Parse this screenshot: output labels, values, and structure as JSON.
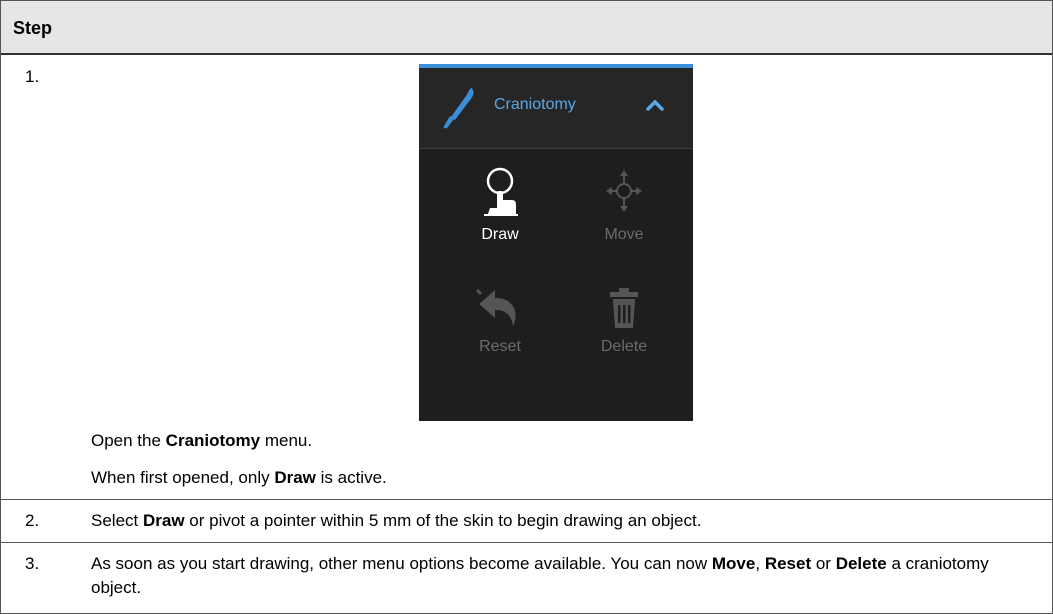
{
  "table": {
    "header": "Step",
    "rows": [
      {
        "num": "1."
      },
      {
        "num": "2."
      },
      {
        "num": "3."
      }
    ]
  },
  "step1": {
    "open_pre": "Open the ",
    "open_bold": "Craniotomy",
    "open_post": " menu.",
    "active_pre": "When first opened, only ",
    "active_bold": "Draw",
    "active_post": " is active."
  },
  "step2": {
    "pre": "Select ",
    "bold": "Draw",
    "post": " or pivot a pointer within 5 mm of the skin to begin drawing an object."
  },
  "step3": {
    "t1": "As soon as you start drawing, other menu options become available. You can now ",
    "b1": "Move",
    "t2": ", ",
    "b2": "Reset",
    "t3": " or ",
    "b3": "Delete",
    "t4": " a craniotomy object."
  },
  "menu": {
    "title": "Craniotomy",
    "accent": "#3b8ed8",
    "title_color": "#5aa7e6",
    "tools": [
      {
        "label": "Draw",
        "icon": "draw-icon",
        "enabled": true
      },
      {
        "label": "Move",
        "icon": "move-icon",
        "enabled": false
      },
      {
        "label": "Reset",
        "icon": "reset-icon",
        "enabled": false
      },
      {
        "label": "Delete",
        "icon": "delete-icon",
        "enabled": false
      }
    ]
  }
}
